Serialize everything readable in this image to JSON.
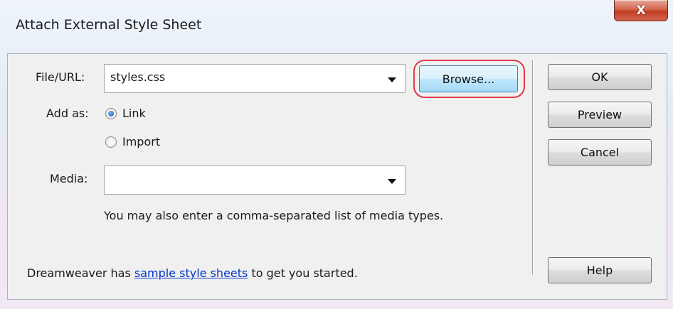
{
  "window": {
    "title": "Attach External Style Sheet",
    "close_glyph": "X"
  },
  "form": {
    "file_url_label": "File/URL:",
    "file_url_value": "styles.css",
    "add_as_label": "Add as:",
    "option_link": "Link",
    "option_import": "Import",
    "selected_option": "Link",
    "media_label": "Media:",
    "media_value": "",
    "media_hint": "You may also enter a comma-separated list of media types.",
    "footer_prefix": "Dreamweaver has",
    "footer_link": "sample style sheets",
    "footer_suffix": "to get you started."
  },
  "buttons": {
    "browse": "Browse...",
    "ok": "OK",
    "preview": "Preview",
    "cancel": "Cancel",
    "help": "Help"
  },
  "colors": {
    "highlight_ring": "#e23a4b",
    "close_button": "#c23e22",
    "link": "#0033cc"
  }
}
